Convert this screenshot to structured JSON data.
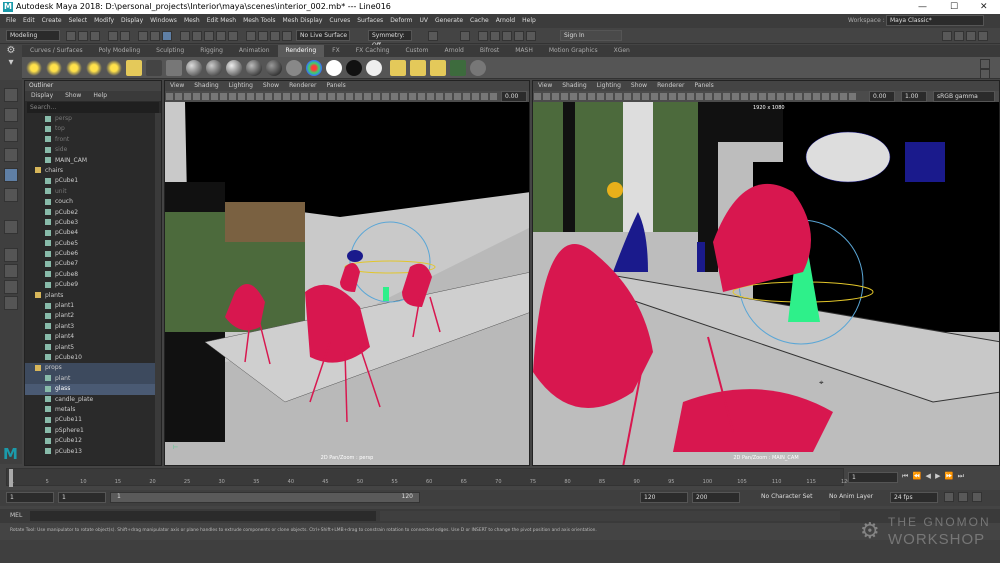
{
  "window": {
    "title": "Autodesk Maya 2018: D:\\personal_projects\\Interior\\maya\\scenes\\interior_002.mb* --- Line016",
    "minimize": "—",
    "maximize": "☐",
    "close": "✕"
  },
  "menu": [
    "File",
    "Edit",
    "Create",
    "Select",
    "Modify",
    "Display",
    "Windows",
    "Mesh",
    "Edit Mesh",
    "Mesh Tools",
    "Mesh Display",
    "Curves",
    "Surfaces",
    "Deform",
    "UV",
    "Generate",
    "Cache",
    "Arnold",
    "Help"
  ],
  "workspace": {
    "label": "Workspace :",
    "value": "Maya Classic*"
  },
  "statusline": {
    "mode": "Modeling",
    "live_surface": "No Live Surface",
    "symmetry": "Symmetry: Off",
    "sign_in": "Sign In"
  },
  "shelf_tabs": [
    "Curves / Surfaces",
    "Poly Modeling",
    "Sculpting",
    "Rigging",
    "Animation",
    "Rendering",
    "FX",
    "FX Caching",
    "Custom",
    "Arnold",
    "Bifrost",
    "MASH",
    "Motion Graphics",
    "XGen"
  ],
  "active_shelf_tab": "Rendering",
  "outliner": {
    "title": "Outliner",
    "menu": [
      "Display",
      "Show",
      "Help"
    ],
    "search_placeholder": "Search...",
    "items": [
      {
        "label": "persp",
        "dim": true,
        "indent": 1
      },
      {
        "label": "top",
        "dim": true,
        "indent": 1
      },
      {
        "label": "front",
        "dim": true,
        "indent": 1
      },
      {
        "label": "side",
        "dim": true,
        "indent": 1
      },
      {
        "label": "MAIN_CAM",
        "dim": false,
        "indent": 1
      },
      {
        "label": "chairs",
        "dim": false,
        "indent": 0
      },
      {
        "label": "pCube1",
        "dim": false,
        "indent": 1
      },
      {
        "label": "unit",
        "dim": true,
        "indent": 1
      },
      {
        "label": "couch",
        "dim": false,
        "indent": 1
      },
      {
        "label": "pCube2",
        "dim": false,
        "indent": 1
      },
      {
        "label": "pCube3",
        "dim": false,
        "indent": 1
      },
      {
        "label": "pCube4",
        "dim": false,
        "indent": 1
      },
      {
        "label": "pCube5",
        "dim": false,
        "indent": 1
      },
      {
        "label": "pCube6",
        "dim": false,
        "indent": 1
      },
      {
        "label": "pCube7",
        "dim": false,
        "indent": 1
      },
      {
        "label": "pCube8",
        "dim": false,
        "indent": 1
      },
      {
        "label": "pCube9",
        "dim": false,
        "indent": 1
      },
      {
        "label": "plants",
        "dim": false,
        "indent": 0
      },
      {
        "label": "plant1",
        "dim": false,
        "indent": 1
      },
      {
        "label": "plant2",
        "dim": false,
        "indent": 1
      },
      {
        "label": "plant3",
        "dim": false,
        "indent": 1
      },
      {
        "label": "plant4",
        "dim": false,
        "indent": 1
      },
      {
        "label": "plant5",
        "dim": false,
        "indent": 1
      },
      {
        "label": "pCube10",
        "dim": false,
        "indent": 1
      },
      {
        "label": "props",
        "dim": false,
        "indent": 0,
        "sel": "sel2"
      },
      {
        "label": "plant",
        "dim": false,
        "indent": 1,
        "sel": "sel2"
      },
      {
        "label": "glass",
        "dim": false,
        "indent": 1,
        "sel": "sel"
      },
      {
        "label": "candle_plate",
        "dim": false,
        "indent": 1
      },
      {
        "label": "metals",
        "dim": false,
        "indent": 1
      },
      {
        "label": "pCube11",
        "dim": false,
        "indent": 1
      },
      {
        "label": "pSphere1",
        "dim": false,
        "indent": 1
      },
      {
        "label": "pCube12",
        "dim": false,
        "indent": 1
      },
      {
        "label": "pCube13",
        "dim": false,
        "indent": 1
      }
    ]
  },
  "viewport_left": {
    "menu": [
      "View",
      "Shading",
      "Lighting",
      "Show",
      "Renderer",
      "Panels"
    ],
    "field": "0.00",
    "label": "2D Pan/Zoom : persp"
  },
  "viewport_right": {
    "menu": [
      "View",
      "Shading",
      "Lighting",
      "Show",
      "Renderer",
      "Panels"
    ],
    "field1": "0.00",
    "field2": "1.00",
    "colorspace": "sRGB gamma",
    "resolution": "1920 x 1080",
    "label": "2D Pan/Zoom : MAIN_CAM"
  },
  "timeline": {
    "ticks": [
      "1",
      "5",
      "10",
      "15",
      "20",
      "25",
      "30",
      "35",
      "40",
      "45",
      "50",
      "55",
      "60",
      "65",
      "70",
      "75",
      "80",
      "85",
      "90",
      "95",
      "100",
      "105",
      "110",
      "115",
      "120"
    ],
    "current_frame": "1"
  },
  "range": {
    "start": "1",
    "start2": "1",
    "slider_start": "1",
    "slider_end": "120",
    "end": "120",
    "end2": "200",
    "character_set": "No Character Set",
    "anim_layer": "No Anim Layer",
    "fps": "24 fps"
  },
  "mel": {
    "label": "MEL"
  },
  "help_line": "Rotate Tool: Use manipulator to rotate object(s). Shift+drag manipulator axis or plane handles to extrude components or clone objects. Ctrl+Shift+LMB+drag to constrain rotation to connected edges. Use D or INSERT to change the pivot position and axis orientation.",
  "watermark": {
    "line1": "THE GNOMON",
    "line2": "WORKSHOP"
  },
  "colors": {
    "accent": "#4a5a73",
    "chair": "#d8174f",
    "wire": "#1a1a8c",
    "selected": "#2ef08a"
  }
}
